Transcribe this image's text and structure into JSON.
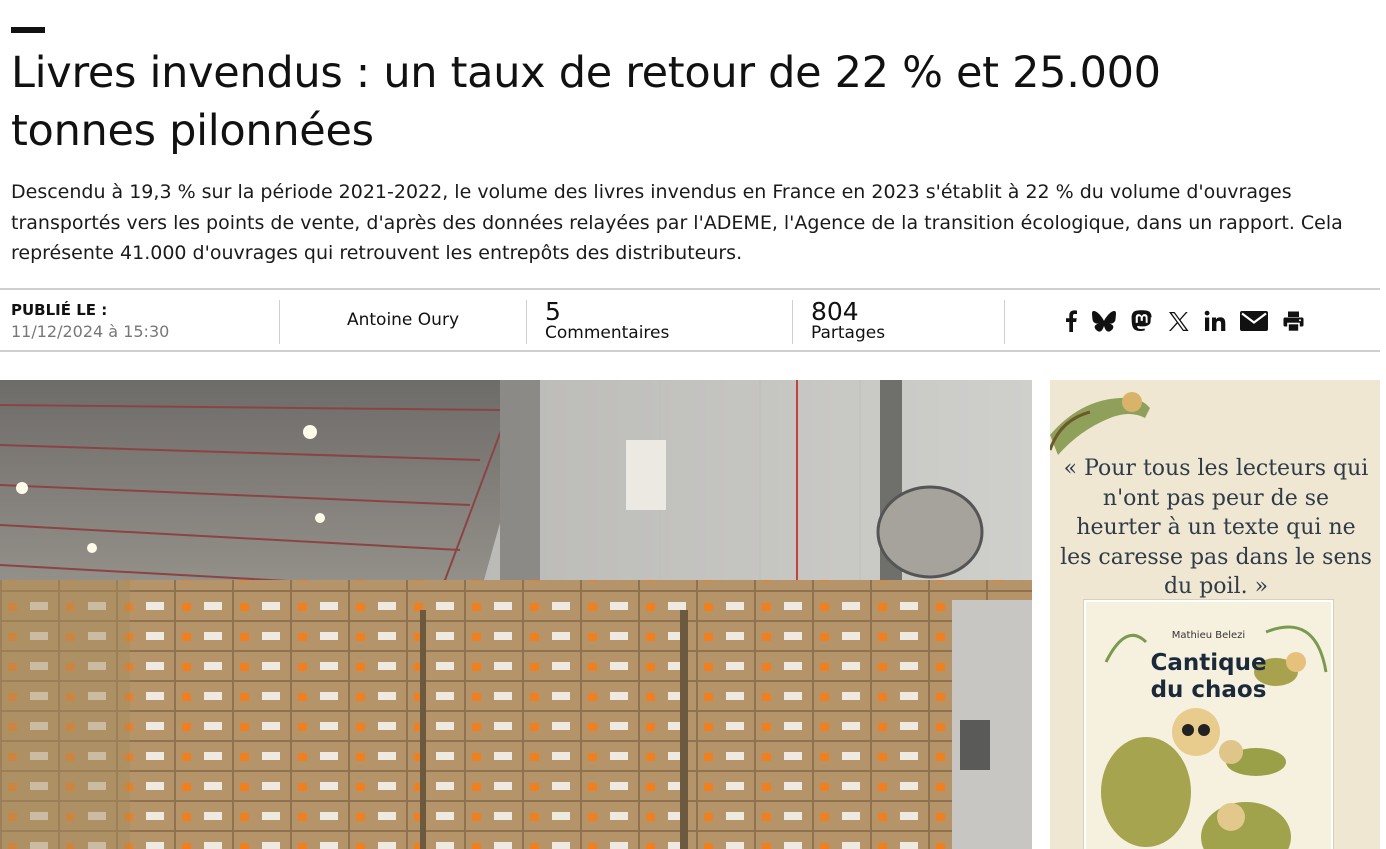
{
  "article": {
    "title": "Livres invendus : un taux de retour de 22 % et 25.000 tonnes pilonnées",
    "lead": "Descendu à 19,3 % sur la période 2021-2022, le volume des livres invendus en France en 2023 s'établit à 22 % du volume d'ouvrages transportés vers les points de vente, d'après des données relayées par l'ADEME, l'Agence de la transition écologique, dans un rapport. Cela représente 41.000 d'ouvrages qui retrouvent les entrepôts des distributeurs."
  },
  "meta": {
    "published_label": "PUBLIÉ LE :",
    "published_date": "11/12/2024 à 15:30",
    "author": "Antoine Oury",
    "comments_count": "5",
    "comments_label": "Commentaires",
    "shares_count": "804",
    "shares_label": "Partages"
  },
  "share_icons": [
    "facebook-icon",
    "bluesky-icon",
    "mastodon-icon",
    "x-icon",
    "linkedin-icon",
    "email-icon",
    "print-icon"
  ],
  "ad": {
    "quote": "« Pour tous les lecteurs qui n'ont pas peur de se heurter à un texte qui ne les caresse pas dans le sens du poil. »",
    "book_author": "Mathieu Belezi",
    "book_title_line1": "Cantique",
    "book_title_line2": "du chaos",
    "background": "#efe7d1"
  }
}
